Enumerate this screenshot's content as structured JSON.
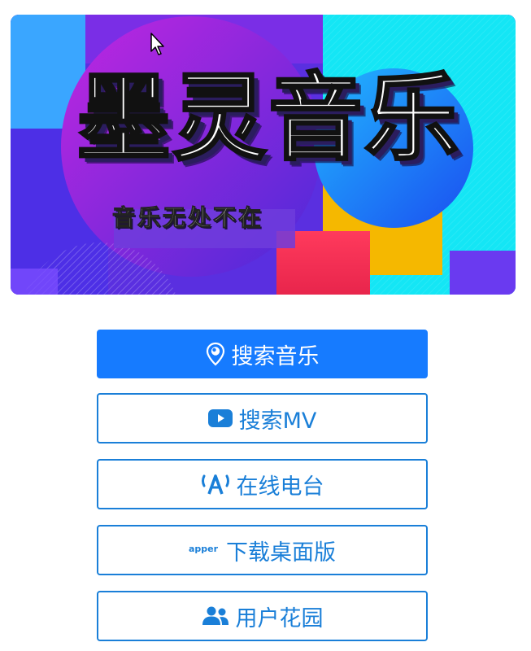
{
  "banner": {
    "title": "墨灵音乐",
    "subtitle": "音乐无处不在"
  },
  "colors": {
    "primary": "#167bff",
    "outline": "#1a7fd8"
  },
  "buttons": [
    {
      "label": "搜索音乐",
      "icon": "map-pin-icon",
      "style": "primary"
    },
    {
      "label": "搜索MV",
      "icon": "youtube-play-icon",
      "style": "outline"
    },
    {
      "label": "在线电台",
      "icon": "radio-broadcast-icon",
      "style": "outline"
    },
    {
      "label": "下载桌面版",
      "icon_text": "apper",
      "style": "outline"
    },
    {
      "label": "用户花园",
      "icon": "users-icon",
      "style": "outline"
    }
  ]
}
